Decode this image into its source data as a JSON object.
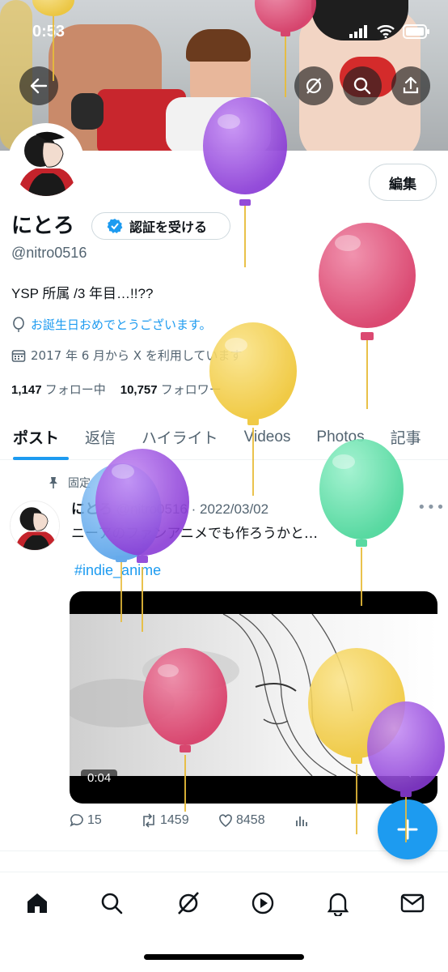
{
  "status_bar": {
    "time": "0:53"
  },
  "banner_buttons": {
    "back": "back-arrow",
    "explore": "grok-icon",
    "search": "search-icon",
    "share": "share-icon"
  },
  "profile": {
    "edit_label": "編集",
    "name": "にとろ",
    "verify_label": "認証を受ける",
    "handle": "@nitro0516",
    "bio": "YSP 所属 /3 年目…!!??",
    "birthday": "お誕生日おめでとうございます。",
    "joined": "2017 年 6 月から X を利用しています",
    "following_count": "1,147",
    "following_label": "フォロー中",
    "followers_count": "10,757",
    "followers_label": "フォロワー"
  },
  "tabs": [
    {
      "label": "ポスト",
      "active": true
    },
    {
      "label": "返信"
    },
    {
      "label": "ハイライト"
    },
    {
      "label": "Videos"
    },
    {
      "label": "Photos"
    },
    {
      "label": "記事"
    }
  ],
  "post": {
    "pinned_label": "固定",
    "author": "にとろ",
    "meta": "@nitro0516 · 2022/03/02",
    "text": "ニーアのファンアニメでも作ろうかと…",
    "hashtag": "#indie_anime",
    "duration": "0:04",
    "replies": "15",
    "reposts": "1459",
    "likes": "8458"
  },
  "colors": {
    "accent": "#1d9bf0",
    "balloon_purple": "#9b4dde",
    "balloon_pink": "#e04d78",
    "balloon_yellow": "#f3cf47",
    "balloon_green": "#5fe0a7",
    "balloon_blue": "#5aa9f0"
  }
}
